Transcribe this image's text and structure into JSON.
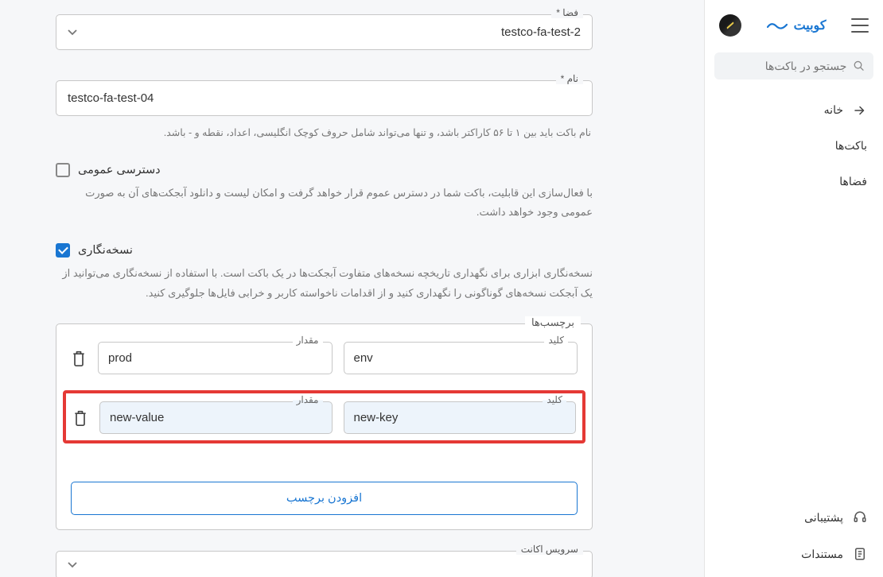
{
  "header": {
    "brand": "کوبیت"
  },
  "search": {
    "placeholder": "جستجو در باکت‌ها"
  },
  "nav": {
    "home": "خانه",
    "buckets": "باکت‌ها",
    "spaces": "فضاها",
    "support": "پشتیبانی",
    "docs": "مستندات"
  },
  "form": {
    "space_label": "فضا *",
    "space_value": "testco-fa-test-2",
    "name_label": "نام *",
    "name_value": "testco-fa-test-04",
    "name_helper": "نام باکت باید بین ۱ تا ۵۶ کاراکتر باشد، و تنها می‌تواند شامل حروف کوچک انگلیسی، اعداد، نقطه و - باشد.",
    "public_access_label": "دسترسی عمومی",
    "public_access_desc": "با فعال‌سازی این قابلیت، باکت شما در دسترس عموم قرار خواهد گرفت و امکان لیست و دانلود آبجکت‌های آن به صورت عمومی وجود خواهد داشت.",
    "versioning_label": "نسخه‌نگاری",
    "versioning_desc": "نسخه‌نگاری ابزاری برای نگهداری تاریخچه نسخه‌های متفاوت آبجکت‌ها در یک باکت است. با استفاده از نسخه‌نگاری می‌توانید از یک آبجکت نسخه‌های گوناگونی را نگهداری کنید و از اقدامات ناخواسته کاربر و خرابی فایل‌ها جلوگیری کنید.",
    "tags_legend": "برچسب‌ها",
    "tag_key_label": "کلید",
    "tag_value_label": "مقدار",
    "tags": [
      {
        "key": "env",
        "value": "prod"
      },
      {
        "key": "new-key",
        "value": "new-value"
      }
    ],
    "add_tag": "افزودن برچسب",
    "service_account_label": "سرویس اکانت"
  }
}
